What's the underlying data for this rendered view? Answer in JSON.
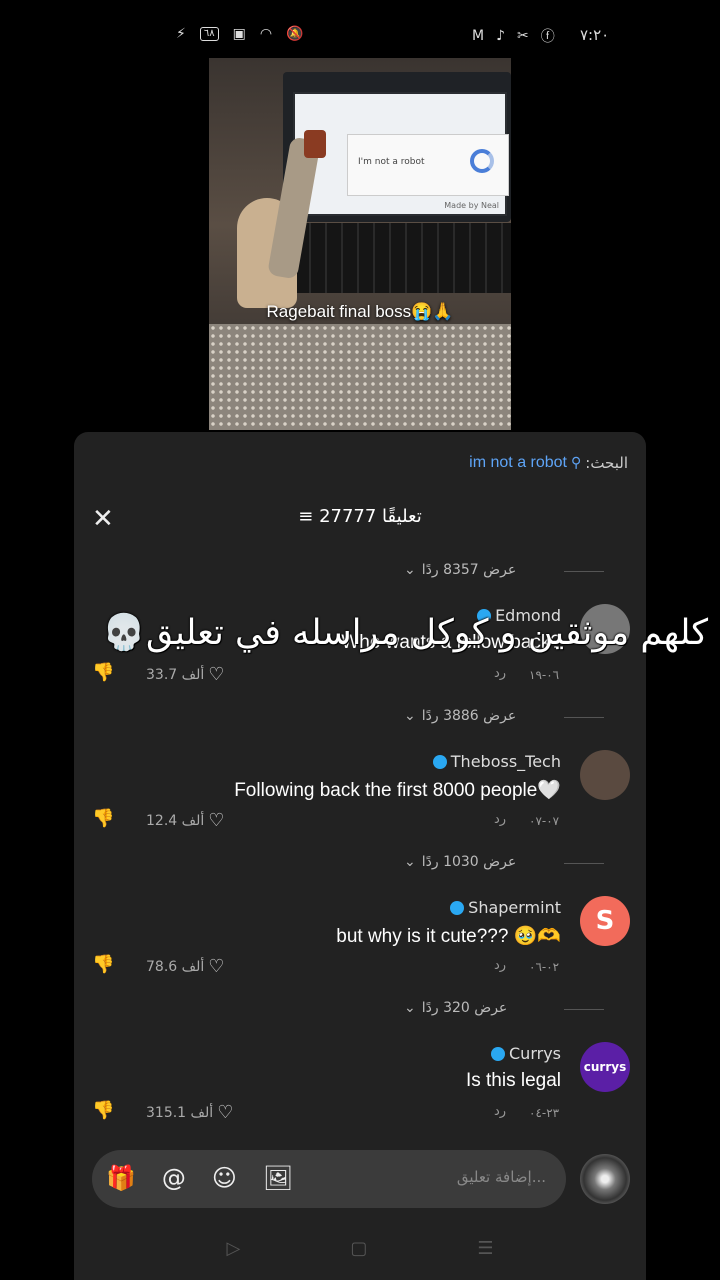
{
  "status_bar": {
    "time": "٧:٢٠",
    "battery": "٦٨",
    "left_icons": [
      "charging-bolt-icon",
      "battery-icon",
      "sim-off-icon",
      "wifi-icon",
      "mute-bell-icon"
    ],
    "right_icons": [
      "gmail-icon",
      "tiktok-icon",
      "capcut-icon",
      "facebook-icon"
    ]
  },
  "video": {
    "caption": "Ragebait final boss😭🙏",
    "captcha_text": "I'm not a robot",
    "made_by_text": "Made by Neal"
  },
  "panel": {
    "search_label": "البحث:",
    "search_term": "im not a robot",
    "comment_count": "27777 تعليقًا",
    "comments": [
      {
        "replies": "عرض 8357 ردًا",
        "user": "Edmond",
        "text": "Who wants a follow back?",
        "date": "٠٦-١٩",
        "reply_label": "رد",
        "likes": "33.7 ألف",
        "avatar_color": "#777777"
      },
      {
        "replies": "عرض 3886 ردًا",
        "user": "Theboss_Tech",
        "text": "Following back the first 8000 people🤍",
        "date": "٠٧-٠٧",
        "reply_label": "رد",
        "likes": "12.4 ألف",
        "avatar_color": "#5a4a40"
      },
      {
        "replies": "عرض 1030 ردًا",
        "user": "Shapermint",
        "text": "but why is it cute??? 🥹🫶",
        "date": "٠٢-٠٦",
        "reply_label": "رد",
        "likes": "78.6 ألف",
        "avatar_color": "#f26b5b",
        "avatar_letter": "S"
      },
      {
        "replies": "عرض 320 ردًا",
        "user": "Currys",
        "text": "Is this legal",
        "date": "٢٣-٠٤",
        "reply_label": "رد",
        "likes": "315.1 ألف",
        "avatar_color": "#5b1fa6",
        "avatar_letter": "currys"
      }
    ],
    "input_placeholder": "إضافة تعليق...",
    "input_icons": [
      "gift-icon",
      "mention-icon",
      "emoji-icon",
      "image-icon"
    ]
  },
  "overlay_text": "كلهم موثقين و كوكل مراسله في تعليق💀"
}
